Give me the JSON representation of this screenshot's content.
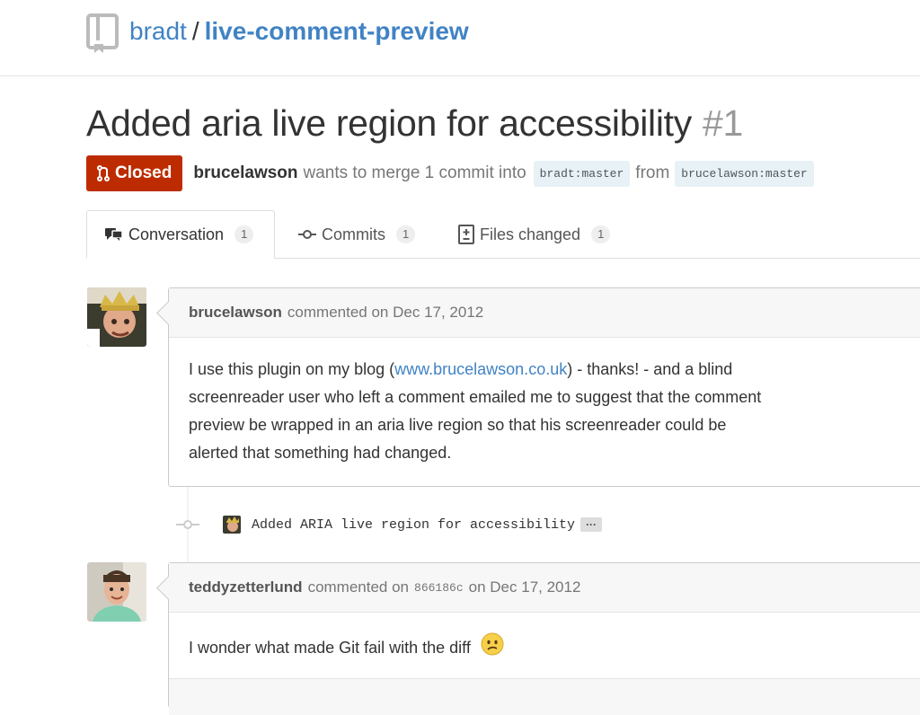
{
  "repo": {
    "owner": "bradt",
    "separator": "/",
    "name": "live-comment-preview",
    "icon": "repo-icon"
  },
  "pull_request": {
    "title": "Added aria live region for accessibility",
    "number": "#1",
    "state": "Closed",
    "state_color": "#bd2c00",
    "author": "brucelawson",
    "merge_text": "wants to merge 1 commit into",
    "base_branch": "bradt:master",
    "from_text": "from",
    "head_branch": "brucelawson:master"
  },
  "tabs": [
    {
      "label": "Conversation",
      "count": "1",
      "icon": "comment-discussion-icon"
    },
    {
      "label": "Commits",
      "count": "1",
      "icon": "git-commit-icon"
    },
    {
      "label": "Files changed",
      "count": "1",
      "icon": "diff-icon"
    }
  ],
  "comments": [
    {
      "author": "brucelawson",
      "action": "commented on",
      "date": "Dec 17, 2012",
      "body_before": "I use this plugin on my blog (",
      "link": "www.brucelawson.co.uk",
      "body_after": ") - thanks! - and a blind screenreader user who left a comment emailed me to suggest that the comment preview be wrapped in an aria live region so that his screenreader could be alerted that something had changed."
    },
    {
      "author": "teddyzetterlund",
      "action": "commented on",
      "sha": "866186c",
      "on": "on",
      "date": "Dec 17, 2012",
      "body": "I wonder what made Git fail with the diff",
      "emoji": "confused-face-icon"
    }
  ],
  "commit_event": {
    "message": "Added ARIA live region for accessibility",
    "ellipsis": "···"
  },
  "colors": {
    "link": "#4183c4",
    "closed": "#bd2c00",
    "branch_bg": "#e8f1f6"
  }
}
